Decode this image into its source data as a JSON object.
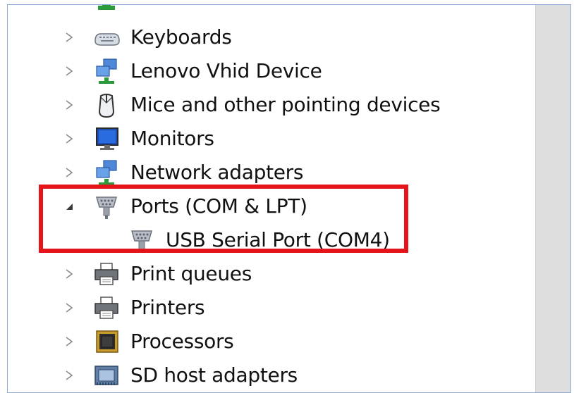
{
  "device_tree": {
    "items": [
      {
        "label": "Keyboards",
        "icon": "keyboard-icon",
        "expanded": false
      },
      {
        "label": "Lenovo Vhid Device",
        "icon": "network-device-icon",
        "expanded": false
      },
      {
        "label": "Mice and other pointing devices",
        "icon": "mouse-icon",
        "expanded": false
      },
      {
        "label": "Monitors",
        "icon": "monitor-icon",
        "expanded": false
      },
      {
        "label": "Network adapters",
        "icon": "network-adapter-icon",
        "expanded": false
      },
      {
        "label": "Ports (COM & LPT)",
        "icon": "port-icon",
        "expanded": true
      },
      {
        "label": "USB Serial Port (COM4)",
        "icon": "port-icon",
        "child": true
      },
      {
        "label": "Print queues",
        "icon": "printer-icon",
        "expanded": false
      },
      {
        "label": "Printers",
        "icon": "printer-icon",
        "expanded": false
      },
      {
        "label": "Processors",
        "icon": "processor-icon",
        "expanded": false
      },
      {
        "label": "SD host adapters",
        "icon": "sd-adapter-icon",
        "expanded": false
      }
    ]
  },
  "colors": {
    "highlight": "#e5141a",
    "expander": "#8a8a8a",
    "scrollbar": "#dedede"
  }
}
